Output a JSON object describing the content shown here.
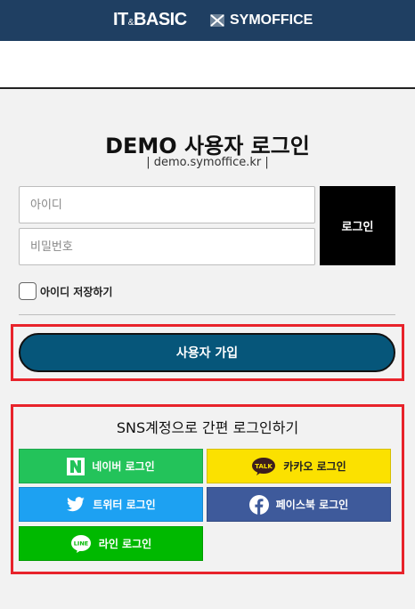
{
  "brand": {
    "left_main": "IT",
    "left_amp": "&",
    "left_tail": "BASIC",
    "right": "SYMOFFICE"
  },
  "login": {
    "title": "DEMO 사용자 로그인",
    "subtitle": "| demo.symoffice.kr |",
    "id_placeholder": "아이디",
    "pw_placeholder": "비밀번호",
    "login_button": "로그인",
    "save_id_label": "아이디 저장하기"
  },
  "signup": {
    "button": "사용자 가입"
  },
  "sns": {
    "title": "SNS계정으로 간편 로그인하기",
    "naver": "네이버 로그인",
    "kakao": "카카오 로그인",
    "twitter": "트위터 로그인",
    "facebook": "페이스북 로그인",
    "line": "라인 로그인",
    "kakao_icon_text": "TALK",
    "line_icon_text": "LINE"
  },
  "colors": {
    "header": "#1f3f62",
    "signup": "#06567a",
    "highlight": "#e8232b",
    "naver": "#23c35a",
    "kakao": "#fbe100",
    "twitter": "#1da1f2",
    "facebook": "#3e5a9b",
    "line": "#00b900"
  }
}
